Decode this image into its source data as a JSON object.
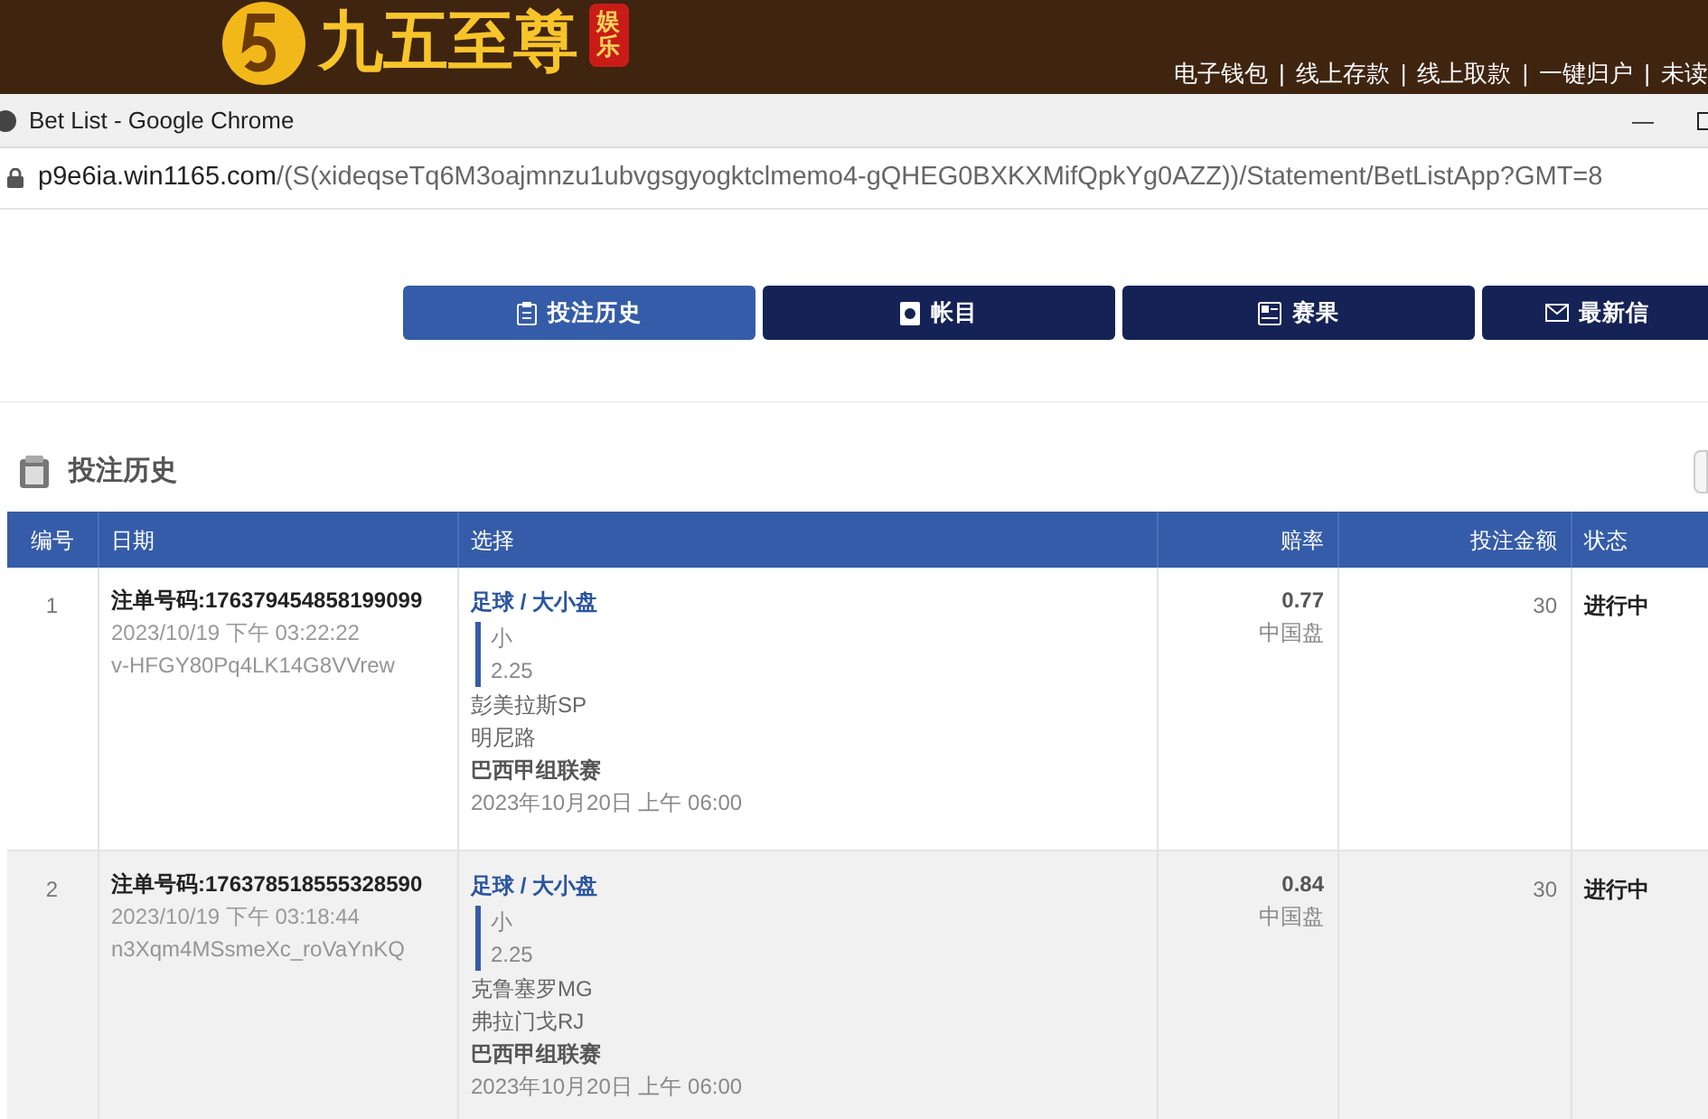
{
  "banner": {
    "logo_text": "九五至尊",
    "logo_tag": "娱乐",
    "links": [
      "电子钱包",
      "线上存款",
      "线上取款",
      "一键归户",
      "未读"
    ],
    "separator": "|"
  },
  "window": {
    "title": "Bet List - Google Chrome",
    "minimize": "—"
  },
  "address_bar": {
    "host": "p9e6ia.win1165.com",
    "path": "/(S(xideqseTq6M3oajmnzu1ubvgsgyogktclmemo4-gQHEG0BXKXMifQpkYg0AZZ))/Statement/BetListApp?GMT=8"
  },
  "tabs": [
    {
      "label": "投注历史",
      "selected": true,
      "kind": "clipboard"
    },
    {
      "label": "帐目",
      "selected": false,
      "kind": "ledger"
    },
    {
      "label": "赛果",
      "selected": false,
      "kind": "results"
    },
    {
      "label": "最新信",
      "selected": false,
      "kind": "mail"
    }
  ],
  "section": {
    "title": "投注历史"
  },
  "table": {
    "columns": [
      "编号",
      "日期",
      "选择",
      "赔率",
      "投注金额",
      "状态"
    ],
    "rows": [
      {
        "number": "1",
        "ticket": "注单号码:176379454858199099",
        "time": "2023/10/19 下午 03:22:22",
        "code": "v-HFGY80Pq4LK14G8VVrew",
        "market": "足球 / 大小盘",
        "pick": "小",
        "line": "2.25",
        "home": "彭美拉斯SP",
        "away": "明尼路",
        "league": "巴西甲组联赛",
        "kickoff": "2023年10月20日 上午 06:00",
        "odds": "0.77",
        "odds_type": "中国盘",
        "stake": "30",
        "status": "进行中"
      },
      {
        "number": "2",
        "ticket": "注单号码:176378518555328590",
        "time": "2023/10/19 下午 03:18:44",
        "code": "n3Xqm4MSsmeXc_roVaYnKQ",
        "market": "足球 / 大小盘",
        "pick": "小",
        "line": "2.25",
        "home": "克鲁塞罗MG",
        "away": "弗拉门戈RJ",
        "league": "巴西甲组联赛",
        "kickoff": "2023年10月20日 上午 06:00",
        "odds": "0.84",
        "odds_type": "中国盘",
        "stake": "30",
        "status": "进行中"
      }
    ]
  }
}
